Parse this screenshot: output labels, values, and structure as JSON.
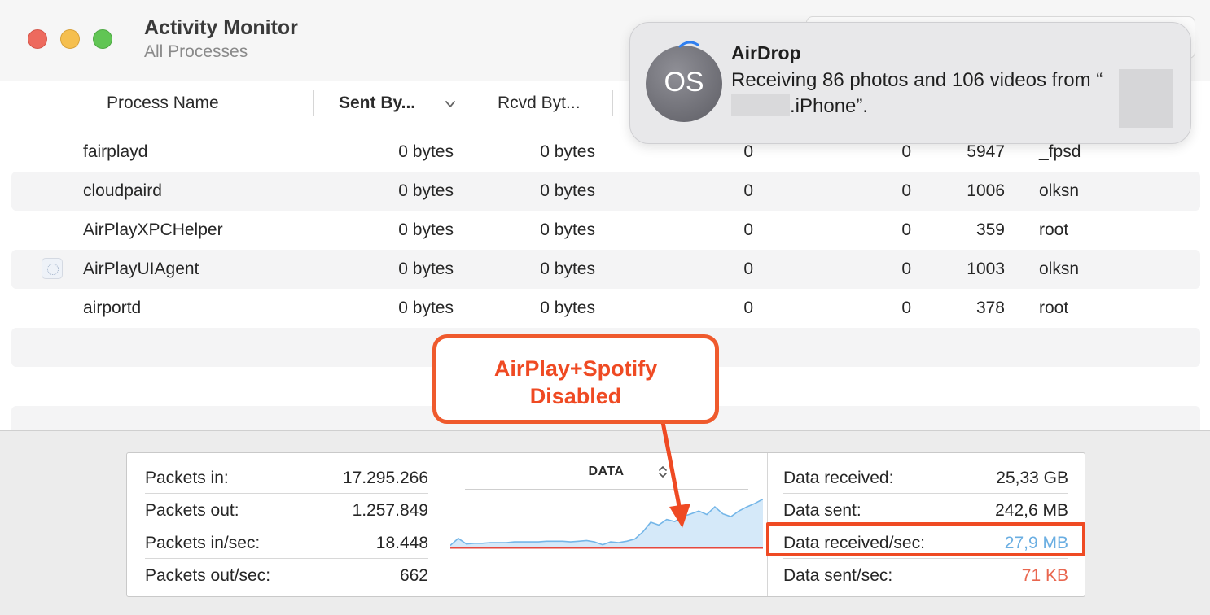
{
  "window": {
    "title": "Activity Monitor",
    "subtitle": "All Processes"
  },
  "columns": {
    "process_name": "Process Name",
    "sent": "Sent By...",
    "rcvd": "Rcvd Byt..."
  },
  "rows": [
    {
      "name": "fairplayd",
      "sent": "0 bytes",
      "rcvd": "0 bytes",
      "a": "0",
      "b": "0",
      "pid": "5947",
      "user": "_fpsd"
    },
    {
      "name": "cloudpaird",
      "sent": "0 bytes",
      "rcvd": "0 bytes",
      "a": "0",
      "b": "0",
      "pid": "1006",
      "user": "olksn"
    },
    {
      "name": "AirPlayXPCHelper",
      "sent": "0 bytes",
      "rcvd": "0 bytes",
      "a": "0",
      "b": "0",
      "pid": "359",
      "user": "root"
    },
    {
      "name": "AirPlayUIAgent",
      "sent": "0 bytes",
      "rcvd": "0 bytes",
      "a": "0",
      "b": "0",
      "pid": "1003",
      "user": "olksn"
    },
    {
      "name": "airportd",
      "sent": "0 bytes",
      "rcvd": "0 bytes",
      "a": "0",
      "b": "0",
      "pid": "378",
      "user": "root"
    }
  ],
  "stats_left": [
    {
      "label": "Packets in:",
      "value": "17.295.266"
    },
    {
      "label": "Packets out:",
      "value": "1.257.849"
    },
    {
      "label": "Packets in/sec:",
      "value": "18.448"
    },
    {
      "label": "Packets out/sec:",
      "value": "662"
    }
  ],
  "stats_right": [
    {
      "label": "Data received:",
      "value": "25,33 GB"
    },
    {
      "label": "Data sent:",
      "value": "242,6 MB"
    },
    {
      "label": "Data received/sec:",
      "value": "27,9 MB"
    },
    {
      "label": "Data sent/sec:",
      "value": "71 KB"
    }
  ],
  "chart": {
    "selector": "DATA"
  },
  "chart_data": {
    "type": "area",
    "series": [
      {
        "values": [
          3,
          13,
          5,
          6,
          6,
          7,
          7,
          7,
          8,
          8,
          8,
          8,
          9,
          9,
          9,
          8,
          9,
          10,
          8,
          4,
          8,
          7,
          9,
          12,
          22,
          36,
          32,
          40,
          37,
          44,
          48,
          52,
          47,
          58,
          48,
          44,
          52,
          58,
          63,
          69
        ]
      },
      {
        "values": [
          0,
          0,
          0,
          0,
          0,
          0,
          0,
          0,
          0,
          0,
          0,
          0,
          0,
          0,
          0,
          0,
          0,
          0,
          0,
          0,
          0,
          0,
          0,
          0,
          0,
          0,
          0,
          0,
          0,
          0,
          0,
          0,
          0,
          0,
          0,
          0,
          0,
          0,
          0,
          0
        ]
      }
    ],
    "colors": {
      "received": "#74b6e8",
      "received_fill": "#d5e9f9",
      "sent": "#e5493f"
    }
  },
  "callout": {
    "line1": "AirPlay+Spotify",
    "line2": "Disabled"
  },
  "notification": {
    "app": "AirDrop",
    "avatar_initials": "OS",
    "body_prefix": "Receiving 86 photos and 106 videos from “",
    "body_suffix": ".iPhone”."
  },
  "colors": {
    "accent_red": "#ef4a23",
    "value_blue": "#6aaee2",
    "value_red": "#e9664f"
  }
}
